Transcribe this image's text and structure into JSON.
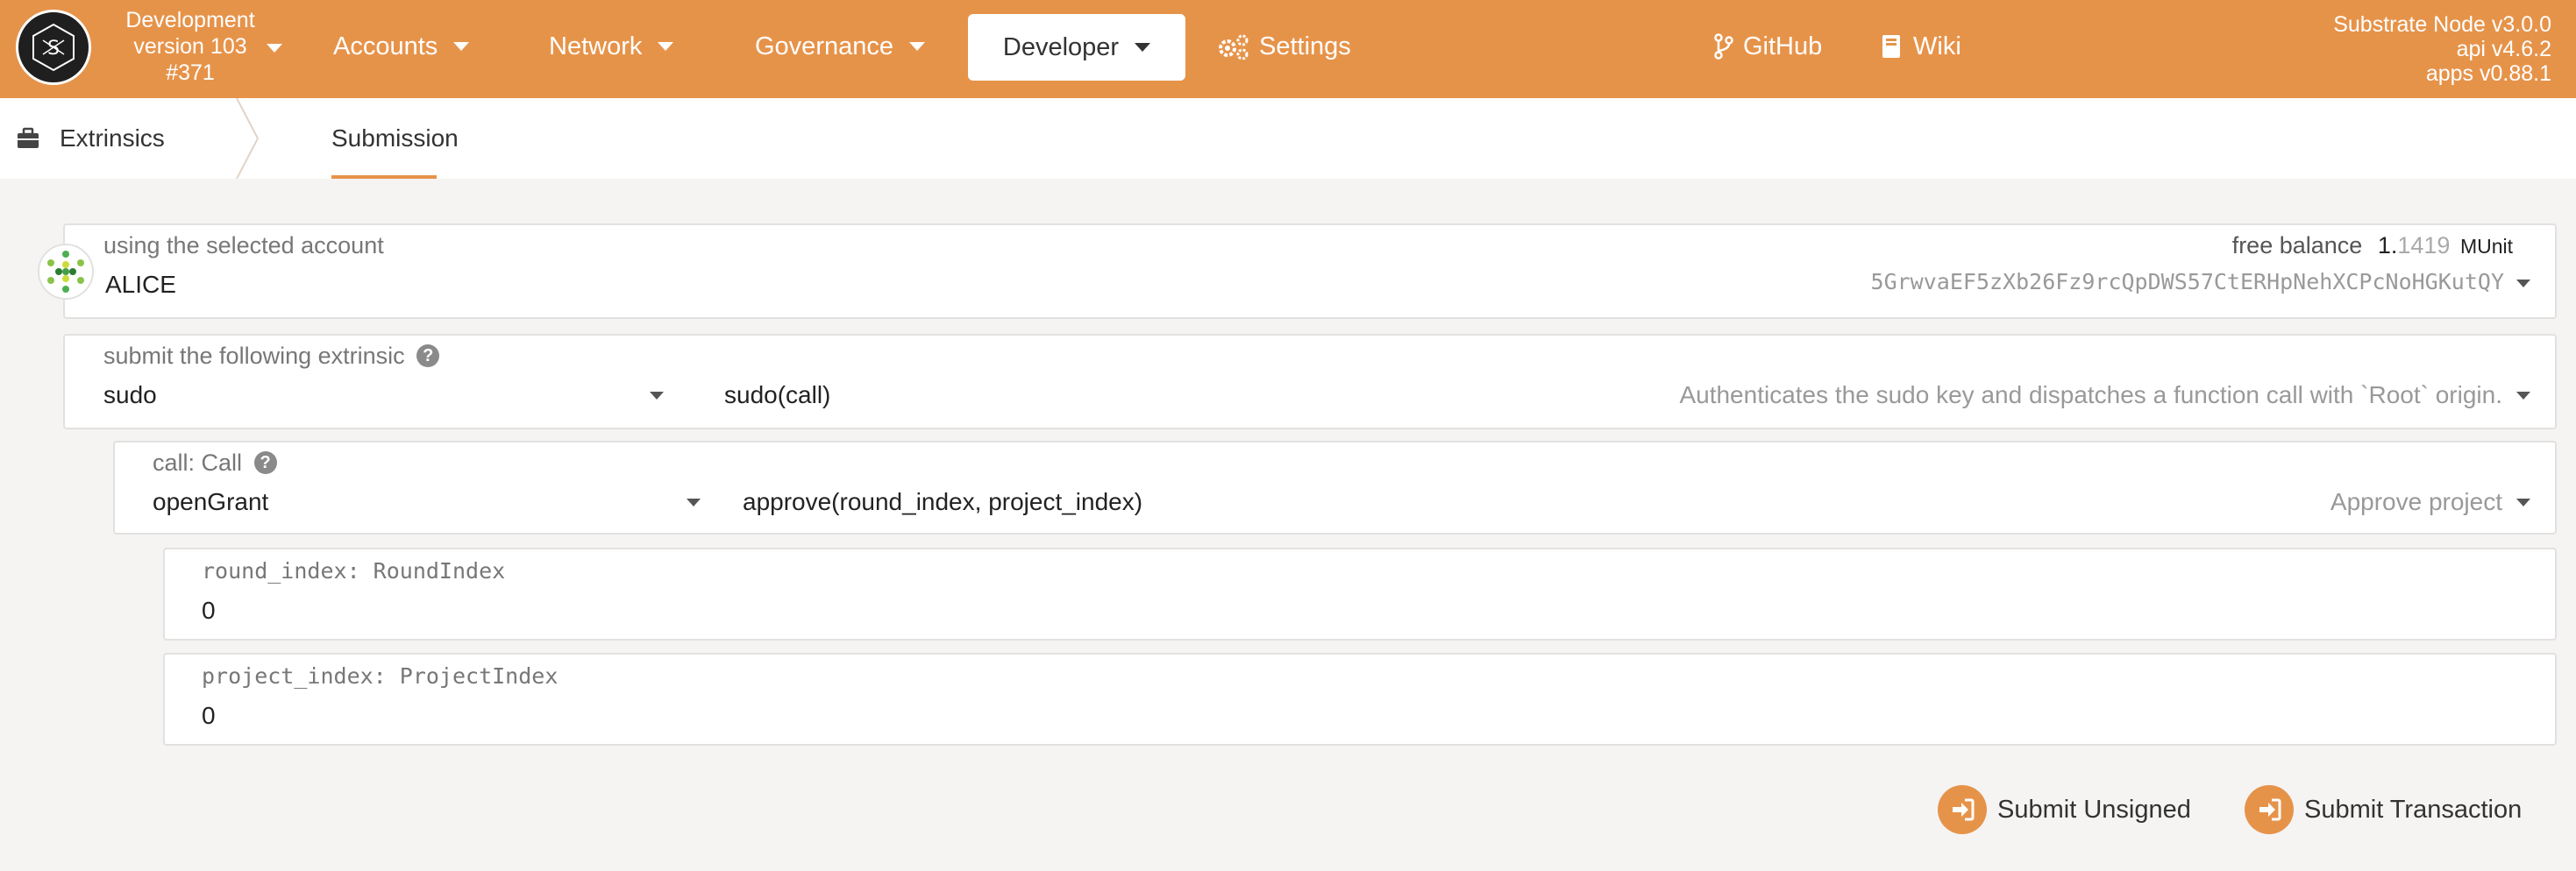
{
  "topbar": {
    "chain_name": "Development",
    "chain_version": "version 103",
    "block": "#371",
    "nav": {
      "accounts": "Accounts",
      "network": "Network",
      "governance": "Governance",
      "developer": "Developer",
      "settings": "Settings",
      "github": "GitHub",
      "wiki": "Wiki"
    },
    "node_version": "Substrate Node v3.0.0",
    "api_version": "api v4.6.2",
    "apps_version": "apps v0.88.1"
  },
  "subnav": {
    "extrinsics": "Extrinsics",
    "submission": "Submission"
  },
  "account": {
    "label": "using the selected account",
    "name": "ALICE",
    "balance_label": "free balance",
    "balance_int": "1.",
    "balance_dec": "1419",
    "balance_unit": "MUnit",
    "address": "5GrwvaEF5zXb26Fz9rcQpDWS57CtERHpNehXCPcNoHGKutQY"
  },
  "extrinsic": {
    "label": "submit the following extrinsic",
    "module": "sudo",
    "method": "sudo(call)",
    "description": "Authenticates the sudo key and dispatches a function call with `Root` origin."
  },
  "call": {
    "label": "call: Call",
    "module": "openGrant",
    "method": "approve(round_index, project_index)",
    "description": "Approve project"
  },
  "params": {
    "round_label": "round_index: RoundIndex",
    "round_value": "0",
    "project_label": "project_index: ProjectIndex",
    "project_value": "0"
  },
  "actions": {
    "submit_unsigned": "Submit Unsigned",
    "submit_transaction": "Submit Transaction"
  },
  "colors": {
    "accent": "#e6934a",
    "background": "#f5f4f3"
  }
}
